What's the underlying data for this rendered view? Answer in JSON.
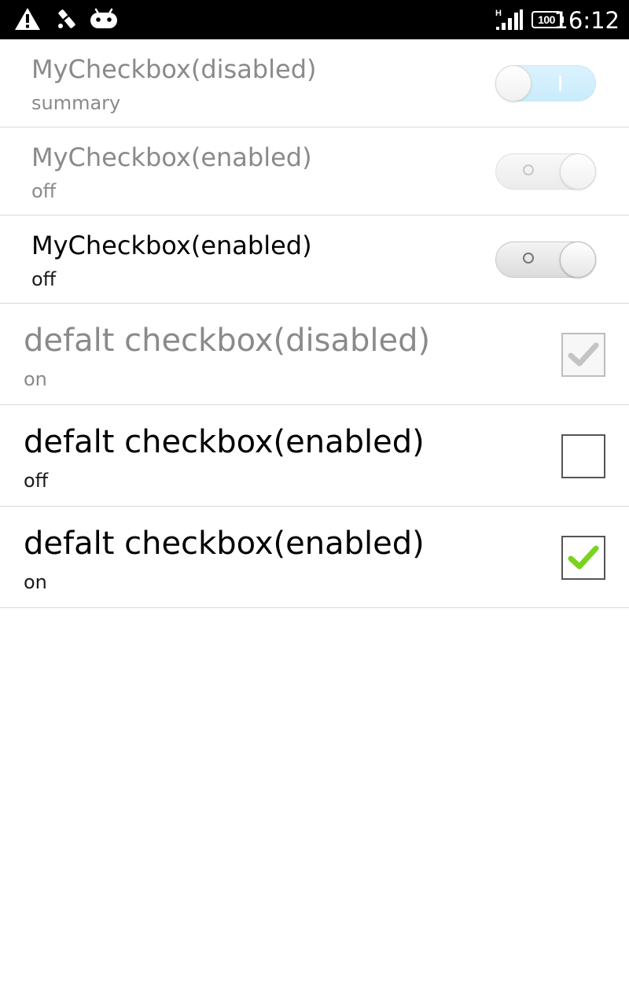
{
  "status_bar": {
    "battery_level": "100",
    "time": "16:12",
    "network_type": "H",
    "icons": [
      "warning-icon",
      "tool-icon",
      "android-icon",
      "signal-icon",
      "battery-icon"
    ]
  },
  "preferences": [
    {
      "title": "MyCheckbox(disabled)",
      "summary": "summary",
      "kind": "switch",
      "checked": true,
      "enabled": false
    },
    {
      "title": "MyCheckbox(enabled)",
      "summary": "off",
      "kind": "switch",
      "checked": false,
      "enabled": false
    },
    {
      "title": "MyCheckbox(enabled)",
      "summary": "off",
      "kind": "switch",
      "checked": false,
      "enabled": true
    },
    {
      "title": "defalt checkbox(disabled)",
      "summary": "on",
      "kind": "checkbox",
      "checked": true,
      "enabled": false
    },
    {
      "title": "defalt checkbox(enabled)",
      "summary": "off",
      "kind": "checkbox",
      "checked": false,
      "enabled": true
    },
    {
      "title": "defalt checkbox(enabled)",
      "summary": "on",
      "kind": "checkbox",
      "checked": true,
      "enabled": true
    }
  ],
  "colors": {
    "status_bar_bg": "#000000",
    "switch_on": "#a8e0fc",
    "check_green": "#7ad31f",
    "disabled_text": "#8a8a8a"
  }
}
